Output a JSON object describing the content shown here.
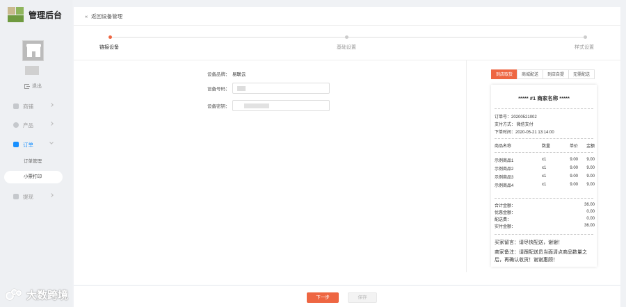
{
  "app": {
    "title": "管理后台"
  },
  "sidebar": {
    "logout": "退出",
    "items": [
      {
        "label": "商铺"
      },
      {
        "label": "产品"
      },
      {
        "label": "订单"
      },
      {
        "label": "提现"
      }
    ],
    "sub_items": [
      {
        "label": "订单管理"
      },
      {
        "label": "小票打印"
      }
    ]
  },
  "topbar": {
    "back_label": "返回设备管理",
    "back_icon": "double-chevron-left-icon"
  },
  "steps": [
    {
      "label": "链接设备",
      "active": true
    },
    {
      "label": "基础设置",
      "active": false
    },
    {
      "label": "样式设置",
      "active": false
    }
  ],
  "form": {
    "brand_label": "设备品牌：",
    "brand_value": "易联云",
    "code_label": "设备号码：",
    "key_label": "设备密钥："
  },
  "receipt_tabs": [
    "到店取货",
    "商城配送",
    "到店自提",
    "无需配送"
  ],
  "receipt": {
    "title": "***** #1  商家名称 *****",
    "order_no": "订单号：20200521002",
    "pay_method": "支付方式：   微信支付",
    "order_time": "下单时间：2020-05-21 13:14:00",
    "headers": [
      "商品名称",
      "数量",
      "单价",
      "金额"
    ],
    "items": [
      [
        "示例商品1",
        "x1",
        "9.00",
        "9.00"
      ],
      [
        "示例商品2",
        "x1",
        "9.00",
        "9.00"
      ],
      [
        "示例商品3",
        "x1",
        "9.00",
        "9.00"
      ],
      [
        "示例商品4",
        "x1",
        "9.00",
        "9.00"
      ]
    ],
    "totals": [
      [
        "合计金额：",
        "36.00"
      ],
      [
        "优惠金额：",
        "0.00"
      ],
      [
        "配送费：",
        "0.00"
      ],
      [
        "实付金额：",
        "36.00"
      ]
    ],
    "buyer_note": "买家留言：请尽快配送，谢谢！",
    "seller_note": "商家备注：请跟配送员当面清点商品数量之后，再确认收货！谢谢惠顾！"
  },
  "footer": {
    "next_label": "下一步",
    "save_label": "保存"
  },
  "watermark": {
    "text": "大数跨境"
  },
  "colors": {
    "accent": "#ee6642",
    "nav_active": "#1890ff"
  }
}
